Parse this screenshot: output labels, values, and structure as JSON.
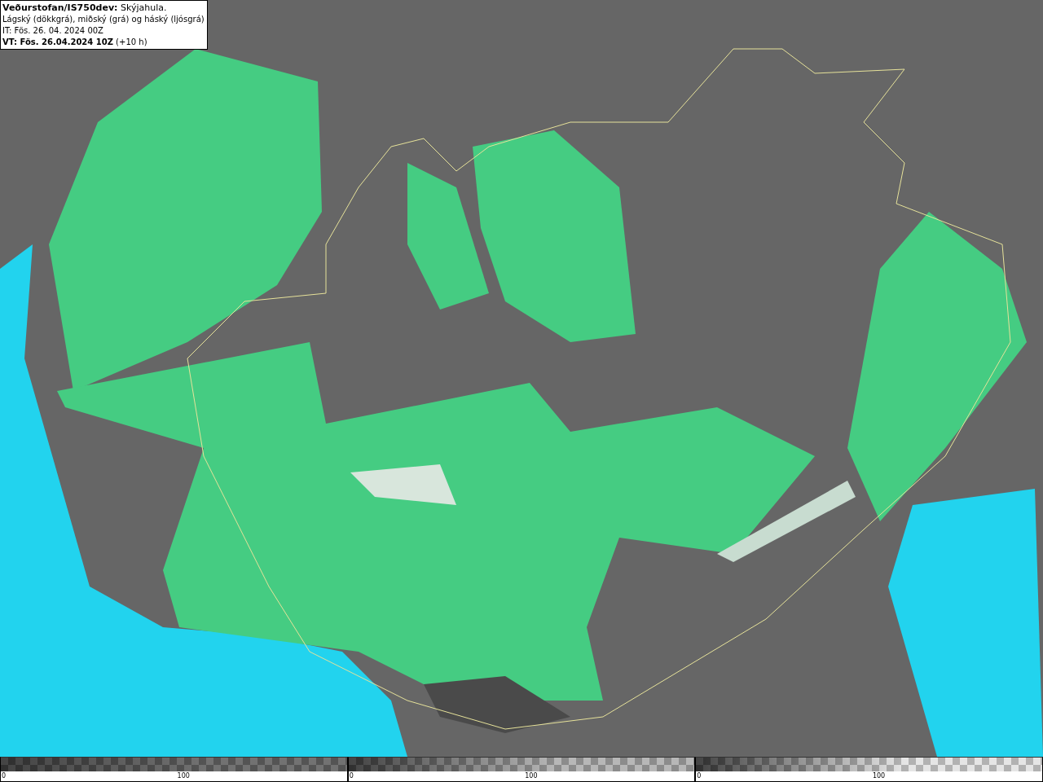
{
  "legend": {
    "lines": [
      "**Veðurstofan/IS750dev:** Skýjahula.",
      "Lágský (dökkgrá), miðský (grá) og háský (ljósgrá)",
      "IT: Fös. 26. 04. 2024 00Z",
      "**VT: Fös. 26.04.2024 10Z** (+10 h)"
    ]
  },
  "colorbars": [
    {
      "color": "#6c6c6c",
      "ticks": [
        "0",
        "100"
      ]
    },
    {
      "color": "#b4b4b4",
      "ticks": [
        "0",
        "100"
      ]
    },
    {
      "color": "#e4e4e4",
      "ticks": [
        "0",
        "100"
      ]
    }
  ]
}
